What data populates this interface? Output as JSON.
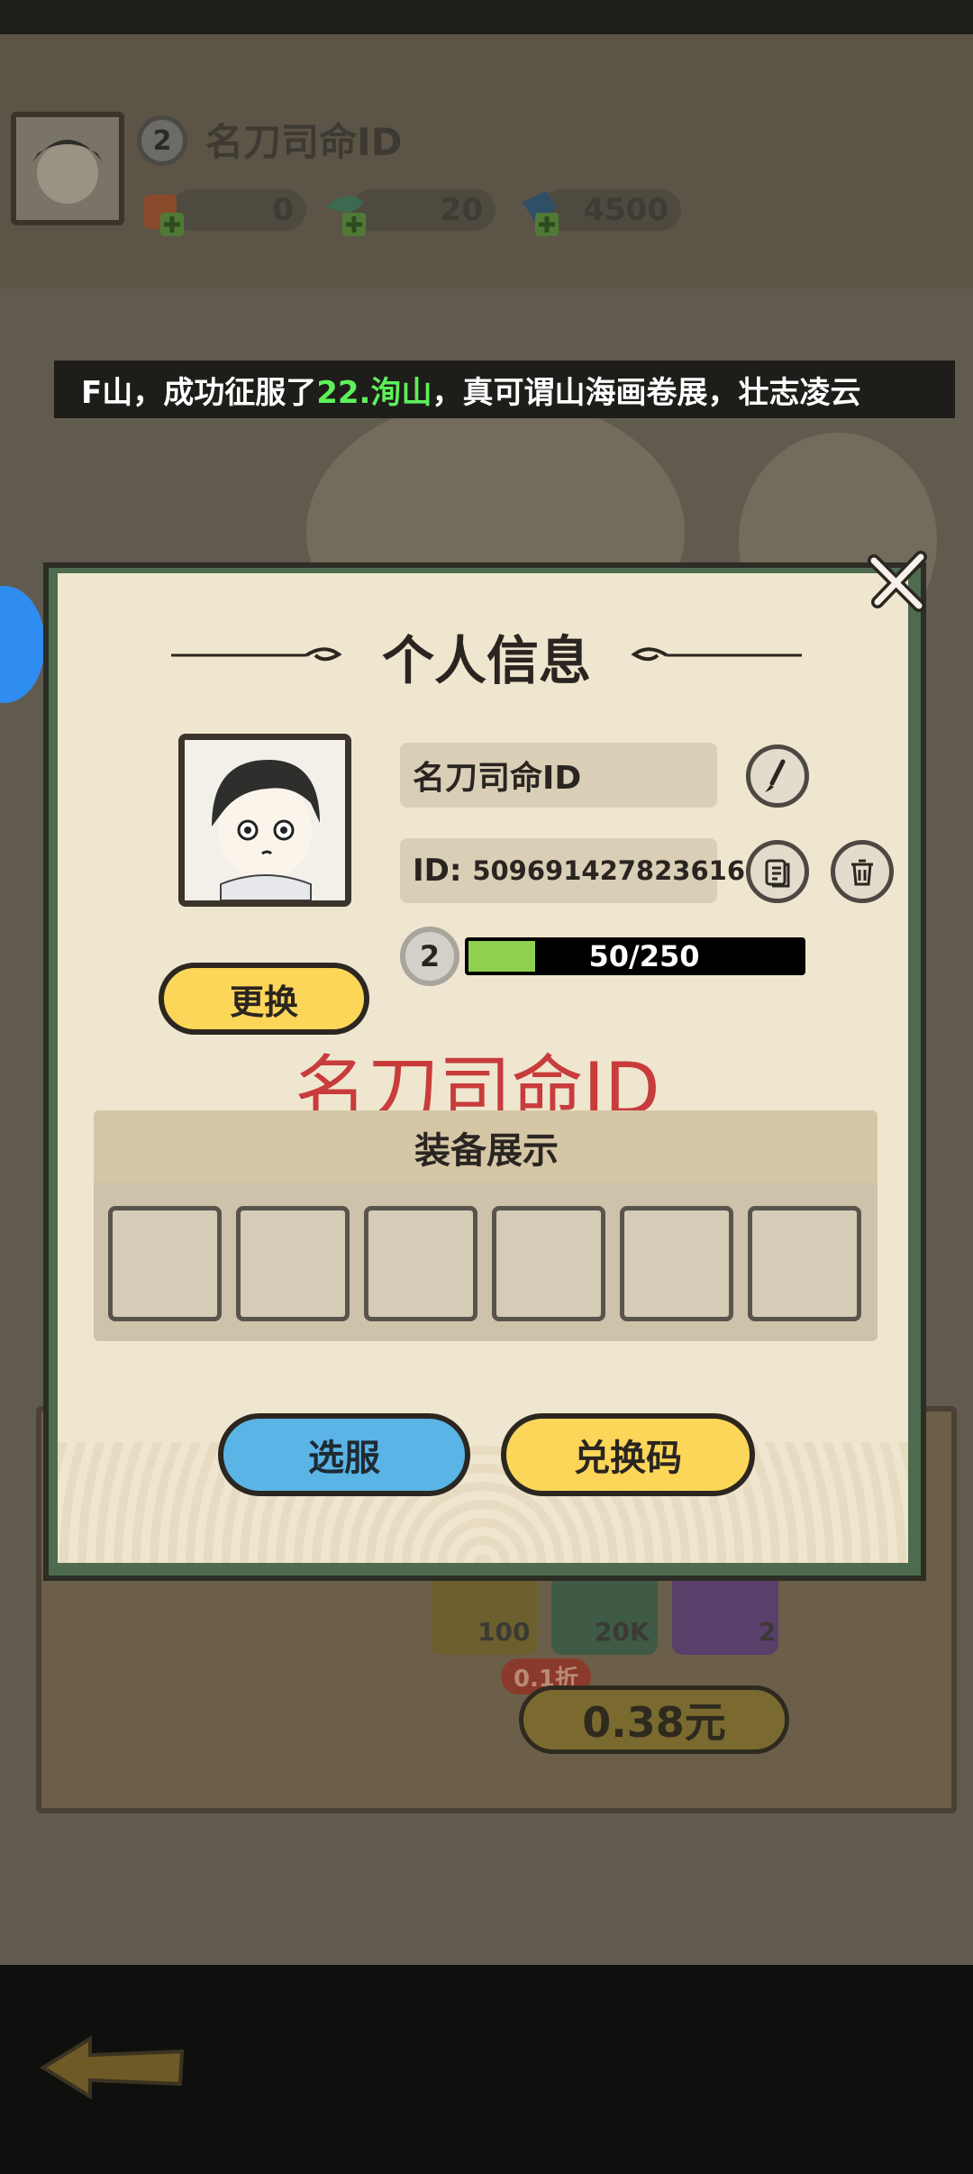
{
  "player": {
    "name": "名刀司命ID",
    "level": "2",
    "id_label": "ID:",
    "id_value": "509691427823616"
  },
  "resources": [
    {
      "icon": "gift-bag-icon",
      "value": "0"
    },
    {
      "icon": "jade-dragon-icon",
      "value": "20"
    },
    {
      "icon": "crystal-icon",
      "value": "4500"
    }
  ],
  "ticker": {
    "prefix": "F山，成功征服了",
    "highlight": "22.洵山",
    "suffix": "，真可谓山海画卷展，壮志凌云"
  },
  "modal": {
    "title": "个人信息",
    "name_field": "名刀司命ID",
    "xp_text": "50/250",
    "xp_fraction": 0.2,
    "change_button": "更换",
    "display_name": "名刀司命ID",
    "equipment_title": "装备展示",
    "equipment_slots": [
      "",
      "",
      "",
      "",
      "",
      ""
    ],
    "server_button": "选服",
    "redeem_button": "兑换码"
  },
  "shop": {
    "items": [
      {
        "icon": "jade-item-icon",
        "count": "100"
      },
      {
        "icon": "crystal-item-icon",
        "count": "20K"
      },
      {
        "icon": "cloud-item-icon",
        "count": "2"
      }
    ],
    "discount": "0.1折",
    "price": "0.38元"
  },
  "colors": {
    "accent_yellow": "#fbd658",
    "accent_blue": "#5ab4e6",
    "modal_frame": "#4f6b4f",
    "highlight_green": "#5ef05a",
    "name_red": "#c83c3c"
  }
}
